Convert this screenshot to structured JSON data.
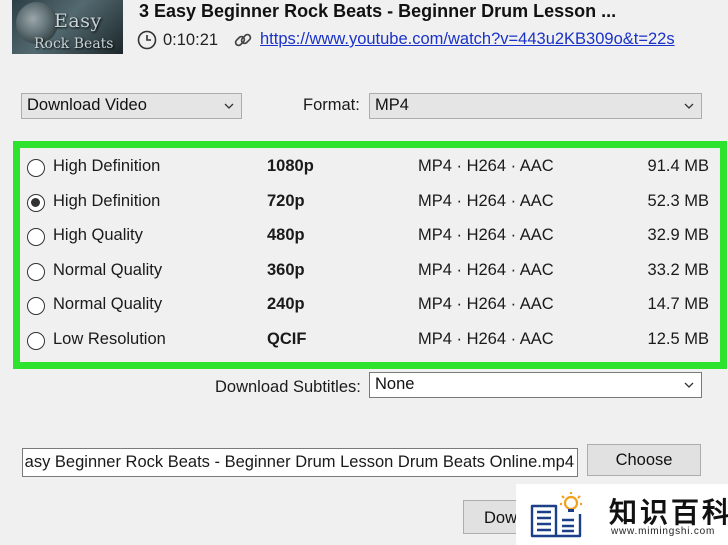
{
  "header": {
    "thumbnail_text_line1": "Easy",
    "thumbnail_text_line2": "Rock Beats",
    "title": "3 Easy Beginner Rock Beats - Beginner Drum Lesson ...",
    "duration": "0:10:21",
    "url": "https://www.youtube.com/watch?v=443u2KB309o&t=22s"
  },
  "controls": {
    "download_type_value": "Download Video",
    "format_label": "Format:",
    "format_value": "MP4"
  },
  "qualities": [
    {
      "name": "High Definition",
      "resolution": "1080p",
      "codec": "MP4 · H264 · AAC",
      "size": "91.4 MB",
      "selected": false
    },
    {
      "name": "High Definition",
      "resolution": "720p",
      "codec": "MP4 · H264 · AAC",
      "size": "52.3 MB",
      "selected": true
    },
    {
      "name": "High Quality",
      "resolution": "480p",
      "codec": "MP4 · H264 · AAC",
      "size": "32.9 MB",
      "selected": false
    },
    {
      "name": "Normal Quality",
      "resolution": "360p",
      "codec": "MP4 · H264 · AAC",
      "size": "33.2 MB",
      "selected": false
    },
    {
      "name": "Normal Quality",
      "resolution": "240p",
      "codec": "MP4 · H264 · AAC",
      "size": "14.7 MB",
      "selected": false
    },
    {
      "name": "Low Resolution",
      "resolution": "QCIF",
      "codec": "MP4 · H264 · AAC",
      "size": "12.5 MB",
      "selected": false
    }
  ],
  "subtitles": {
    "label": "Download Subtitles:",
    "value": "None"
  },
  "file": {
    "filename": "asy Beginner Rock Beats - Beginner Drum Lesson   Drum Beats Online.mp4",
    "choose_label": "Choose",
    "download_label": "Dow"
  },
  "watermark": {
    "brand": "知识百科",
    "url": "www.mimingshi.com"
  },
  "colors": {
    "highlight_border": "#2de32d",
    "link": "#1a32c8",
    "window_bg": "#f0f0f0"
  }
}
